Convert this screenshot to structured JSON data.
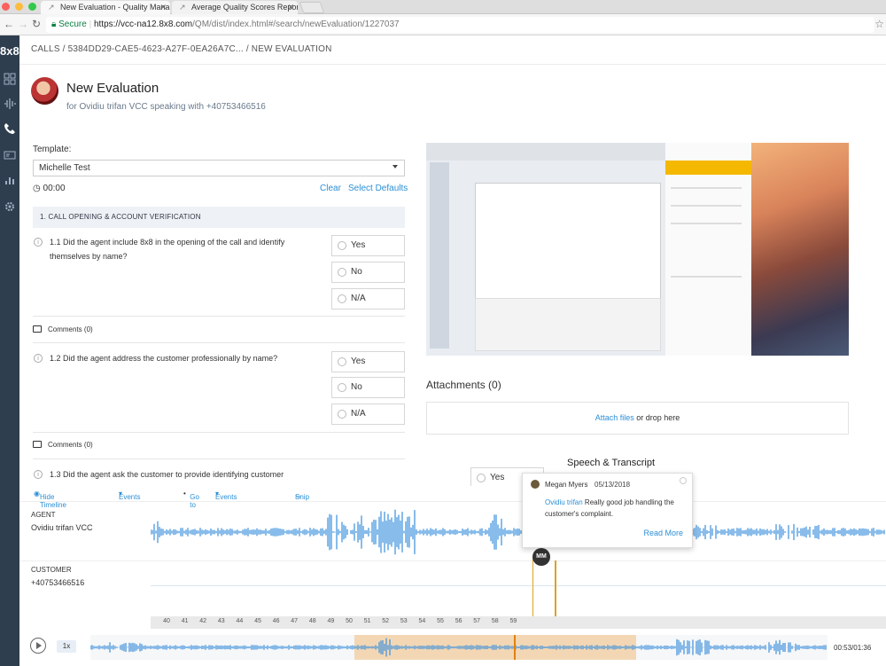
{
  "browser": {
    "tabs": [
      {
        "label": "New Evaluation - Quality Mana"
      },
      {
        "label": "Average Quality Scores Report"
      }
    ],
    "secure_label": "Secure",
    "url_host": "https://vcc-na12.8x8.com",
    "url_path": "/QM/dist/index.html#/search/newEvaluation/1227037"
  },
  "sidebar": {
    "logo": "8x8"
  },
  "breadcrumb": "CALLS / 5384DD29-CAE5-4623-A27F-0EA26A7C... / NEW EVALUATION",
  "header": {
    "title": "New Evaluation",
    "subtitle": "for Ovidiu trifan VCC speaking with +40753466516"
  },
  "template": {
    "label": "Template:",
    "selected": "Michelle Test",
    "timer": "00:00",
    "clear": "Clear",
    "select_defaults": "Select Defaults"
  },
  "section": {
    "title": "1. CALL OPENING & ACCOUNT VERIFICATION"
  },
  "questions": [
    {
      "text": "1.1 Did the agent include 8x8 in the opening of the call and identify themselves by name?"
    },
    {
      "text": "1.2 Did the agent address the customer professionally by name?"
    },
    {
      "text": "1.3 Did the agent ask the customer to provide identifying customer"
    }
  ],
  "options": {
    "yes": "Yes",
    "no": "No",
    "na": "N/A"
  },
  "comments": {
    "label": "Comments (0)"
  },
  "attachments": {
    "title": "Attachments (0)",
    "attach_link": "Attach files",
    "drop_text": " or drop here"
  },
  "speech": {
    "title": "Speech & Transcript"
  },
  "timeline": {
    "hide": "Hide Timeline",
    "events": "Events",
    "goto": "Go to",
    "goto_events": "Events",
    "snip": "Snip",
    "agent_label": "AGENT",
    "agent_name": "Ovidiu trifan VCC",
    "customer_label": "CUSTOMER",
    "customer_number": "+40753466516",
    "ticks": [
      "40",
      "41",
      "42",
      "43",
      "44",
      "45",
      "46",
      "47",
      "48",
      "49",
      "50",
      "51",
      "52",
      "53",
      "54",
      "55",
      "56",
      "57",
      "58",
      "59"
    ],
    "speed": "1x",
    "time": "00:53/01:36",
    "marker_initials": "MM"
  },
  "popup": {
    "author": "Megan Myers",
    "date": "05/13/2018",
    "mention": "Ovidiu trifan",
    "text": " Really good job handling the customer's complaint.",
    "read_more": "Read More"
  },
  "colors": {
    "accent": "#2b8fd6",
    "waveform": "#3a8fdc",
    "sidebar": "#2f3e4f",
    "marker": "#e0a020"
  }
}
